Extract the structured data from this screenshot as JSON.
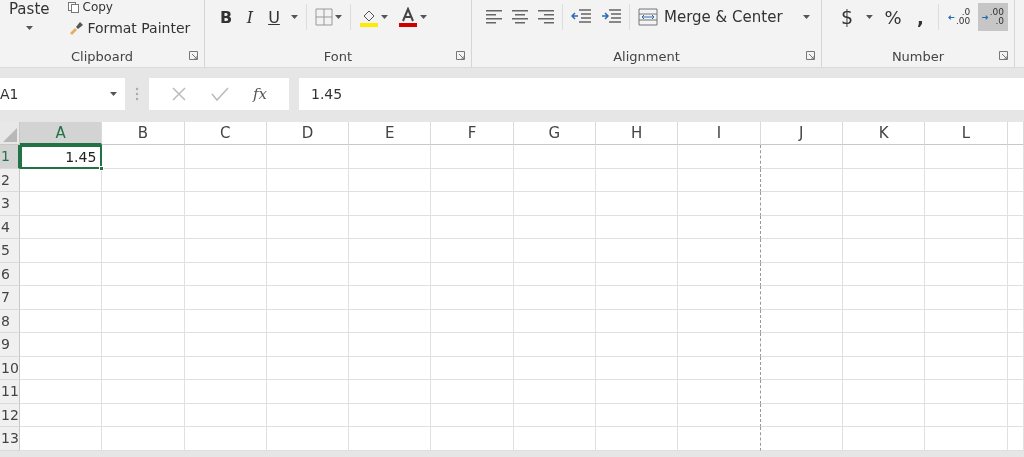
{
  "clipboard": {
    "paste": "Paste",
    "copy": "Copy",
    "format_painter": "Format Painter",
    "label": "Clipboard"
  },
  "font": {
    "label": "Font",
    "bold": "B",
    "italic": "I",
    "underline": "U"
  },
  "alignment": {
    "label": "Alignment",
    "merge": "Merge & Center"
  },
  "number": {
    "label": "Number",
    "currency": "$",
    "percent": "%",
    "comma": ",",
    "decimals": [
      {
        "kind": "increase",
        "top": ".0",
        "bottom": ".00",
        "selected": false
      },
      {
        "kind": "decrease",
        "top": ".00",
        "bottom": ".0",
        "selected": true
      }
    ]
  },
  "formula_bar": {
    "name_box": "A1",
    "fx": "fx",
    "value": "1.45"
  },
  "grid": {
    "columns": [
      {
        "label": "A",
        "selected": true,
        "page_break": false
      },
      {
        "label": "B",
        "selected": false,
        "page_break": false
      },
      {
        "label": "C",
        "selected": false,
        "page_break": false
      },
      {
        "label": "D",
        "selected": false,
        "page_break": false
      },
      {
        "label": "E",
        "selected": false,
        "page_break": false
      },
      {
        "label": "F",
        "selected": false,
        "page_break": false
      },
      {
        "label": "G",
        "selected": false,
        "page_break": false
      },
      {
        "label": "H",
        "selected": false,
        "page_break": false
      },
      {
        "label": "I",
        "selected": false,
        "page_break": true
      },
      {
        "label": "J",
        "selected": false,
        "page_break": false
      },
      {
        "label": "K",
        "selected": false,
        "page_break": false
      },
      {
        "label": "L",
        "selected": false,
        "page_break": false
      }
    ],
    "rows": [
      {
        "label": "1",
        "selected": true,
        "cells": [
          {
            "value": "1.45",
            "selected": true
          }
        ]
      },
      {
        "label": "2",
        "selected": false
      },
      {
        "label": "3",
        "selected": false
      },
      {
        "label": "4",
        "selected": false
      },
      {
        "label": "5",
        "selected": false
      },
      {
        "label": "6",
        "selected": false
      },
      {
        "label": "7",
        "selected": false
      },
      {
        "label": "8",
        "selected": false
      },
      {
        "label": "9",
        "selected": false
      },
      {
        "label": "10",
        "selected": false
      },
      {
        "label": "11",
        "selected": false
      },
      {
        "label": "12",
        "selected": false
      },
      {
        "label": "13",
        "selected": false
      }
    ]
  }
}
